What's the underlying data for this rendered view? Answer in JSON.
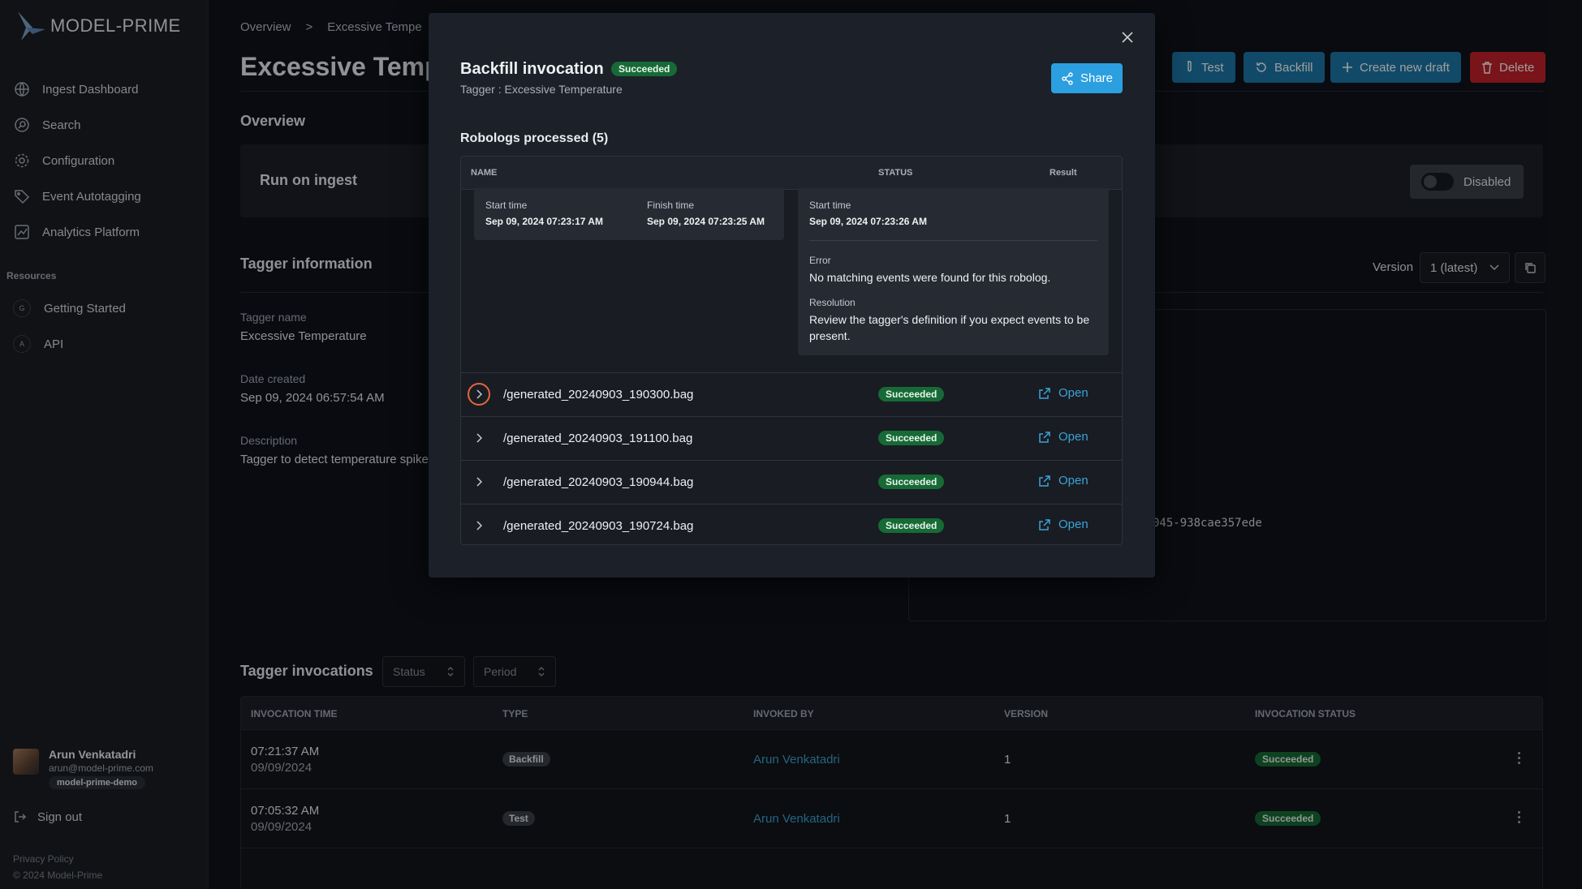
{
  "brand": {
    "name": "MODEL-PRIME"
  },
  "sidebar": {
    "nav": [
      {
        "label": "Ingest Dashboard",
        "icon": "globe-icon"
      },
      {
        "label": "Search",
        "icon": "search-icon"
      },
      {
        "label": "Configuration",
        "icon": "gear-icon"
      },
      {
        "label": "Event Autotagging",
        "icon": "tag-icon"
      },
      {
        "label": "Analytics Platform",
        "icon": "chart-icon"
      }
    ],
    "resources_title": "Resources",
    "resources": [
      {
        "badge": "G",
        "label": "Getting Started"
      },
      {
        "badge": "A",
        "label": "API"
      }
    ],
    "user": {
      "name": "Arun Venkatadri",
      "email": "arun@model-prime.com",
      "org": "model-prime-demo"
    },
    "sign_out": "Sign out",
    "privacy": "Privacy Policy",
    "copyright": "© 2024 Model-Prime"
  },
  "breadcrumb": {
    "root": "Overview",
    "sep": ">",
    "current": "Excessive Tempe"
  },
  "page": {
    "title": "Excessive Temp",
    "buttons": {
      "test": "Test",
      "backfill": "Backfill",
      "draft": "Create new draft",
      "delete": "Delete"
    },
    "overview_title": "Overview",
    "run_on_ingest": "Run on ingest",
    "toggle_label": "Disabled",
    "tagger_info_title": "Tagger information",
    "version_label": "Version",
    "version_value": "1 (latest)",
    "fields": {
      "name_label": "Tagger name",
      "name_value": "Excessive Temperature",
      "created_label": "Date created",
      "created_value": "Sep 09, 2024 06:57:54 AM",
      "desc_label": "Description",
      "desc_value": "Tagger to detect temperature spike"
    },
    "code_fragment": "045-938cae357ede"
  },
  "invocations": {
    "title": "Tagger invocations",
    "filters": {
      "status": "Status",
      "period": "Period"
    },
    "columns": [
      "INVOCATION TIME",
      "TYPE",
      "INVOKED BY",
      "VERSION",
      "INVOCATION STATUS"
    ],
    "rows": [
      {
        "time": "07:21:37 AM",
        "date": "09/09/2024",
        "type": "Backfill",
        "by": "Arun Venkatadri",
        "version": "1",
        "status": "Succeeded"
      },
      {
        "time": "07:05:32 AM",
        "date": "09/09/2024",
        "type": "Test",
        "by": "Arun Venkatadri",
        "version": "1",
        "status": "Succeeded"
      }
    ]
  },
  "modal": {
    "title": "Backfill invocation",
    "badge": "Succeeded",
    "subtitle": "Tagger : Excessive Temperature",
    "share": "Share",
    "robologs_title": "Robologs processed (5)",
    "columns": {
      "name": "NAME",
      "status": "STATUS",
      "result": "Result"
    },
    "detail": {
      "start_label": "Start time",
      "start_value": "Sep 09, 2024 07:23:17 AM",
      "finish_label": "Finish time",
      "finish_value": "Sep 09, 2024 07:23:25 AM",
      "r_start_label": "Start time",
      "r_start_value": "Sep 09, 2024 07:23:26 AM",
      "error_label": "Error",
      "error_value": "No matching events were found for this robolog.",
      "resolution_label": "Resolution",
      "resolution_value": "Review the tagger's definition if you expect events to be present."
    },
    "rows": [
      {
        "name": "/generated_20240903_190300.bag",
        "status": "Succeeded",
        "action": "Open"
      },
      {
        "name": "/generated_20240903_191100.bag",
        "status": "Succeeded",
        "action": "Open"
      },
      {
        "name": "/generated_20240903_190944.bag",
        "status": "Succeeded",
        "action": "Open"
      },
      {
        "name": "/generated_20240903_190724.bag",
        "status": "Succeeded",
        "action": "Open"
      }
    ]
  },
  "colors": {
    "accent": "#1c78a8",
    "share": "#2c9fe0",
    "danger": "#c4212a",
    "success": "#176a35",
    "link": "#3aa3d6",
    "focus": "#e2673b"
  }
}
